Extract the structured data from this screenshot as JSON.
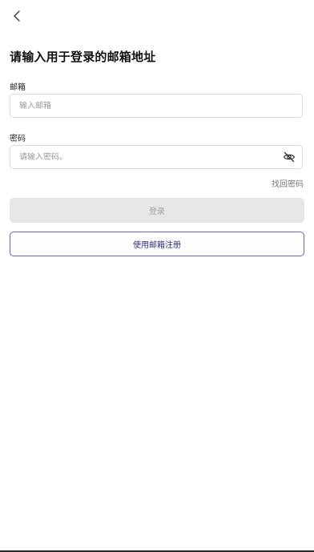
{
  "header": {
    "back_icon": "chevron-left-icon"
  },
  "page": {
    "title": "请输入用于登录的邮箱地址"
  },
  "email": {
    "label": "邮箱",
    "placeholder": "输入邮箱",
    "value": ""
  },
  "password": {
    "label": "密码",
    "placeholder": "请输入密码。",
    "value": "",
    "toggle_icon": "eye-off-icon"
  },
  "links": {
    "forgot_password": "找回密码"
  },
  "buttons": {
    "login": "登录",
    "register": "使用邮箱注册"
  },
  "colors": {
    "accent_border": "#6b5fc7",
    "accent_text": "#2b2a7e",
    "disabled_bg": "#e6e6e6",
    "disabled_text": "#a3a3a3"
  }
}
